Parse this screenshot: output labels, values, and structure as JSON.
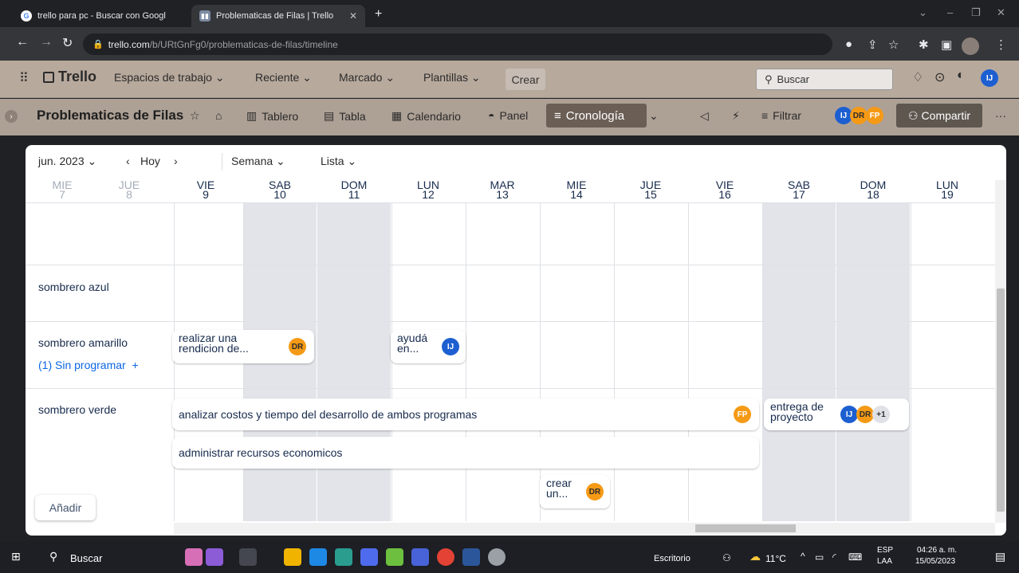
{
  "browser": {
    "tabs": [
      {
        "title": "trello para pc - Buscar con Googl",
        "icon": "google-icon",
        "active": false
      },
      {
        "title": "Problematicas de Filas | Trello",
        "icon": "trello-icon",
        "active": true
      }
    ],
    "url_host": "trello.com",
    "url_path": "/b/URtGnFg0/problematicas-de-filas/timeline"
  },
  "trello_header": {
    "logo": "Trello",
    "menu": [
      "Espacios de trabajo",
      "Reciente",
      "Marcado",
      "Plantillas"
    ],
    "create_label": "Crear",
    "search_placeholder": "Buscar"
  },
  "board": {
    "title": "Problematicas de Filas",
    "views": [
      "Tablero",
      "Tabla",
      "Calendario",
      "Panel"
    ],
    "active_view": "Cronología",
    "filter_label": "Filtrar",
    "share_label": "Compartir",
    "members": [
      "IJ",
      "DR",
      "FP"
    ]
  },
  "timeline": {
    "month": "jun. 2023",
    "today": "Hoy",
    "zoom": "Semana",
    "group_by": "Lista",
    "days": [
      {
        "dow": "MIE",
        "num": "7"
      },
      {
        "dow": "JUE",
        "num": "8"
      },
      {
        "dow": "VIE",
        "num": "9"
      },
      {
        "dow": "SAB",
        "num": "10"
      },
      {
        "dow": "DOM",
        "num": "11"
      },
      {
        "dow": "LUN",
        "num": "12"
      },
      {
        "dow": "MAR",
        "num": "13"
      },
      {
        "dow": "MIE",
        "num": "14"
      },
      {
        "dow": "JUE",
        "num": "15"
      },
      {
        "dow": "VIE",
        "num": "16"
      },
      {
        "dow": "SAB",
        "num": "17"
      },
      {
        "dow": "DOM",
        "num": "18"
      },
      {
        "dow": "LUN",
        "num": "19"
      }
    ],
    "lanes": [
      {
        "name": "sombrero azul"
      },
      {
        "name": "sombrero amarillo",
        "unscheduled": "(1) Sin programar"
      },
      {
        "name": "sombrero verde"
      }
    ],
    "cards": {
      "c1": {
        "text": "realizar una rendicion de...",
        "member": "DR"
      },
      "c2": {
        "text": "ayudá en...",
        "member": "IJ"
      },
      "c3": {
        "text": "analizar costos y tiempo del desarrollo de ambos programas",
        "member": "FP"
      },
      "c4": {
        "text": "entrega de proyecto",
        "members": [
          "IJ",
          "DR"
        ],
        "more": "+1"
      },
      "c5": {
        "text": "administrar recursos economicos"
      },
      "c6": {
        "text": "crear un...",
        "member": "DR"
      }
    },
    "add_label": "Añadir"
  },
  "taskbar": {
    "search": "Buscar",
    "desktop": "Escritorio",
    "weather": "11°C",
    "lang": "ESP",
    "lang2": "LAA",
    "time": "04:26 a. m.",
    "date": "15/05/2023"
  }
}
